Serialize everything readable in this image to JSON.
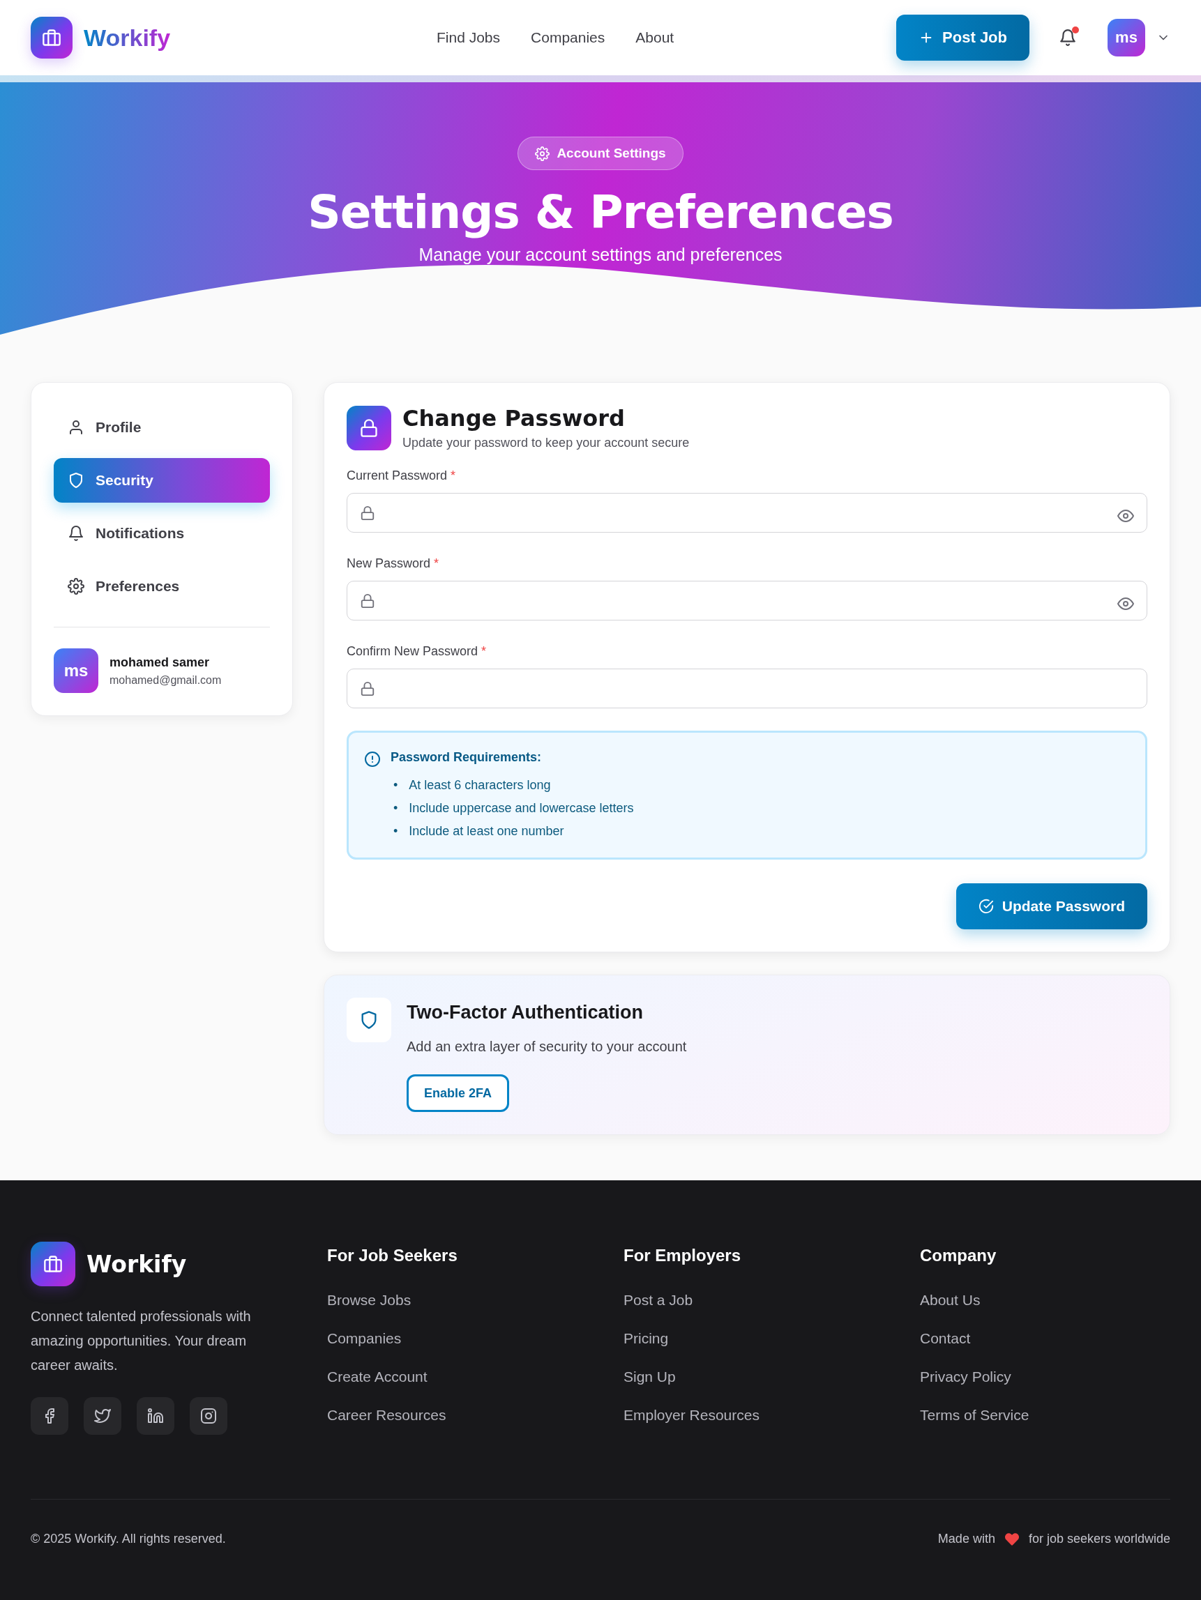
{
  "header": {
    "logo": "Workify",
    "nav": [
      {
        "label": "Find Jobs"
      },
      {
        "label": "Companies"
      },
      {
        "label": "About"
      }
    ],
    "post_button": "Post Job",
    "notifications": {
      "unread": true
    },
    "avatar": "ms"
  },
  "hero": {
    "badge": "Account Settings",
    "title": "Settings & Preferences",
    "subtitle": "Manage your account settings and preferences"
  },
  "sidebar": {
    "items": [
      {
        "label": "Profile",
        "kind": "user",
        "selected": false
      },
      {
        "label": "Security",
        "kind": "shield",
        "selected": true
      },
      {
        "label": "Notifications",
        "kind": "bell",
        "selected": false
      },
      {
        "label": "Preferences",
        "kind": "gear",
        "selected": false
      }
    ],
    "user": {
      "initials": "ms",
      "name": "mohamed samer",
      "email": "mohamed@gmail.com"
    }
  },
  "change_password": {
    "title": "Change Password",
    "subtitle": "Update your password to keep your account secure",
    "fields": [
      {
        "label": "Current Password",
        "marker": "*",
        "kind": "revealable"
      },
      {
        "label": "New Password",
        "marker": "*",
        "kind": "revealable"
      },
      {
        "label": "Confirm New Password",
        "marker": "*",
        "kind": "plain"
      }
    ],
    "requirements": {
      "title": "Password Requirements:",
      "items": [
        {
          "marker": "•",
          "text": "At least 6 characters long"
        },
        {
          "marker": "•",
          "text": "Include uppercase and lowercase letters"
        },
        {
          "marker": "•",
          "text": "Include at least one number"
        }
      ]
    },
    "submit": "Update Password"
  },
  "two_factor": {
    "title": "Two-Factor Authentication",
    "description": "Add an extra layer of security to your account",
    "button": "Enable 2FA"
  },
  "footer": {
    "logo": "Workify",
    "tagline": "Connect talented professionals with amazing opportunities. Your dream career awaits.",
    "social": [
      {
        "kind": "facebook"
      },
      {
        "kind": "twitter"
      },
      {
        "kind": "linkedin"
      },
      {
        "kind": "instagram"
      }
    ],
    "columns": [
      {
        "title": "For Job Seekers",
        "links": [
          "Browse Jobs",
          "Companies",
          "Create Account",
          "Career Resources"
        ]
      },
      {
        "title": "For Employers",
        "links": [
          "Post a Job",
          "Pricing",
          "Sign Up",
          "Employer Resources"
        ]
      },
      {
        "title": "Company",
        "links": [
          "About Us",
          "Contact",
          "Privacy Policy",
          "Terms of Service"
        ]
      }
    ],
    "copyright": "© 2025 Workify. All rights reserved.",
    "made_with": "Made with",
    "made_for": "for job seekers worldwide"
  }
}
